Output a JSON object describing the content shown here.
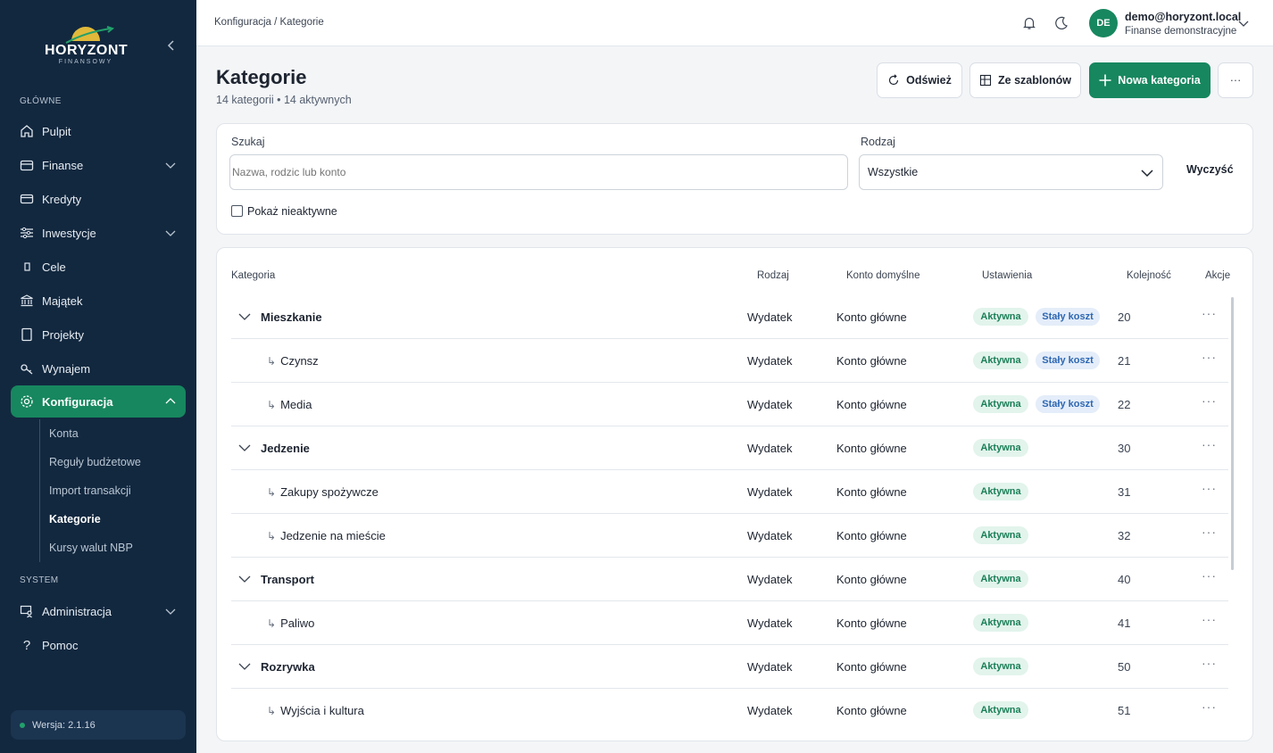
{
  "brand": {
    "name": "HORYZONT",
    "tagline": "FINANSOWY"
  },
  "sidebar": {
    "sections": {
      "main": "GŁÓWNE",
      "system": "SYSTEM"
    },
    "items": [
      {
        "label": "Pulpit",
        "icon": "home-icon"
      },
      {
        "label": "Finanse",
        "icon": "wallet-icon"
      },
      {
        "label": "Kredyty",
        "icon": "credit-card-icon"
      },
      {
        "label": "Inwestycje",
        "icon": "sliders-icon"
      },
      {
        "label": "Cele",
        "icon": "target-icon"
      },
      {
        "label": "Majątek",
        "icon": "bank-icon"
      },
      {
        "label": "Projekty",
        "icon": "document-icon"
      },
      {
        "label": "Wynajem",
        "icon": "key-icon"
      },
      {
        "label": "Konfiguracja",
        "icon": "gear-icon"
      }
    ],
    "sub_items": [
      "Konta",
      "Reguły budżetowe",
      "Import transakcji",
      "Kategorie",
      "Kursy walut NBP"
    ],
    "system_items": [
      {
        "label": "Administracja",
        "icon": "admin-icon"
      },
      {
        "label": "Pomoc",
        "icon": "help-icon"
      }
    ],
    "version": "Wersja: 2.1.16"
  },
  "topbar": {
    "breadcrumb": "Konfiguracja / Kategorie",
    "user": {
      "initials": "DE",
      "email": "demo@horyzont.local",
      "org": "Finanse demonstracyjne"
    }
  },
  "page": {
    "title": "Kategorie",
    "subtitle": "14 kategorii • 14 aktywnych",
    "buttons": {
      "refresh": "Odśwież",
      "templates": "Ze szablonów",
      "new": "Nowa kategoria",
      "more": "···"
    }
  },
  "filters": {
    "search_label": "Szukaj",
    "search_placeholder": "Nazwa, rodzic lub konto",
    "type_label": "Rodzaj",
    "type_value": "Wszystkie",
    "clear": "Wyczyść",
    "show_inactive": "Pokaż nieaktywne"
  },
  "table": {
    "headers": {
      "category": "Kategoria",
      "type": "Rodzaj",
      "account": "Konto domyślne",
      "settings": "Ustawienia",
      "order": "Kolejność",
      "actions": "Akcje"
    },
    "rows": [
      {
        "name": "Mieszkanie",
        "parent": true,
        "type": "Wydatek",
        "account": "Konto główne",
        "status": "Aktywna",
        "fixed": "Stały koszt",
        "order": "20"
      },
      {
        "name": "Czynsz",
        "parent": false,
        "type": "Wydatek",
        "account": "Konto główne",
        "status": "Aktywna",
        "fixed": "Stały koszt",
        "order": "21"
      },
      {
        "name": "Media",
        "parent": false,
        "type": "Wydatek",
        "account": "Konto główne",
        "status": "Aktywna",
        "fixed": "Stały koszt",
        "order": "22"
      },
      {
        "name": "Jedzenie",
        "parent": true,
        "type": "Wydatek",
        "account": "Konto główne",
        "status": "Aktywna",
        "fixed": "",
        "order": "30"
      },
      {
        "name": "Zakupy spożywcze",
        "parent": false,
        "type": "Wydatek",
        "account": "Konto główne",
        "status": "Aktywna",
        "fixed": "",
        "order": "31"
      },
      {
        "name": "Jedzenie na mieście",
        "parent": false,
        "type": "Wydatek",
        "account": "Konto główne",
        "status": "Aktywna",
        "fixed": "",
        "order": "32"
      },
      {
        "name": "Transport",
        "parent": true,
        "type": "Wydatek",
        "account": "Konto główne",
        "status": "Aktywna",
        "fixed": "",
        "order": "40"
      },
      {
        "name": "Paliwo",
        "parent": false,
        "type": "Wydatek",
        "account": "Konto główne",
        "status": "Aktywna",
        "fixed": "",
        "order": "41"
      },
      {
        "name": "Rozrywka",
        "parent": true,
        "type": "Wydatek",
        "account": "Konto główne",
        "status": "Aktywna",
        "fixed": "",
        "order": "50"
      },
      {
        "name": "Wyjścia i kultura",
        "parent": false,
        "type": "Wydatek",
        "account": "Konto główne",
        "status": "Aktywna",
        "fixed": "",
        "order": "51"
      }
    ],
    "child_arrow": "↳",
    "row_actions": "···"
  },
  "colors": {
    "sidebar_bg": "#12283f",
    "accent": "#17875f",
    "active_badge": "#1a7f57",
    "fixed_badge": "#2e67b2"
  }
}
